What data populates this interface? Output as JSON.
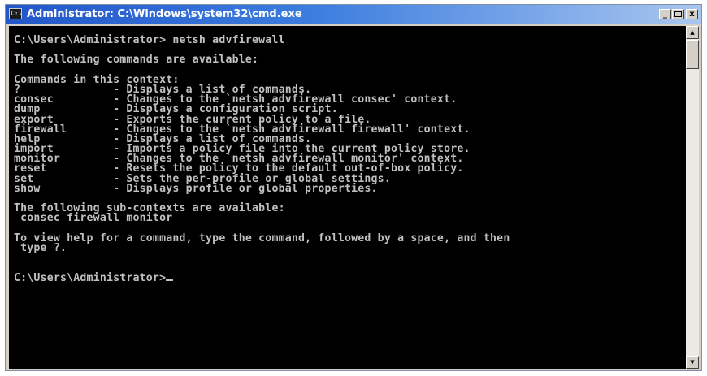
{
  "window": {
    "title": "Administrator: C:\\Windows\\system32\\cmd.exe",
    "icon": "cmd-icon",
    "controls": {
      "minimize": "_",
      "maximize": "□",
      "close": "x"
    }
  },
  "console": {
    "lines": [
      "C:\\Users\\Administrator> netsh advfirewall",
      "",
      "The following commands are available:",
      "",
      "Commands in this context:",
      "?              - Displays a list of commands.",
      "consec         - Changes to the `netsh advfirewall consec' context.",
      "dump           - Displays a configuration script.",
      "export         - Exports the current policy to a file.",
      "firewall       - Changes to the `netsh advfirewall firewall' context.",
      "help           - Displays a list of commands.",
      "import         - Imports a policy file into the current policy store.",
      "monitor        - Changes to the `netsh advfirewall monitor' context.",
      "reset          - Resets the policy to the default out-of-box policy.",
      "set            - Sets the per-profile or global settings.",
      "show           - Displays profile or global properties.",
      "",
      "The following sub-contexts are available:",
      " consec firewall monitor",
      "",
      "To view help for a command, type the command, followed by a space, and then",
      " type ?.",
      "",
      "",
      "C:\\Users\\Administrator>"
    ]
  },
  "scrollbar": {
    "up": "▲",
    "down": "▼"
  },
  "colors": {
    "console_bg": "#000000",
    "console_fg": "#c0c0c0",
    "titlebar": "#2256c9"
  }
}
